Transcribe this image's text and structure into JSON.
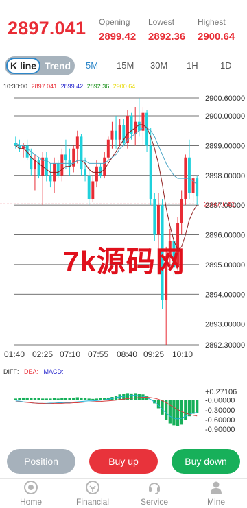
{
  "header": {
    "price": "2897.041",
    "opening_label": "Opening",
    "opening_value": "2899.42",
    "lowest_label": "Lowest",
    "lowest_value": "2892.36",
    "highest_label": "Highest",
    "highest_value": "2900.64"
  },
  "tabs": {
    "kline_label": "K line",
    "trend_label": "Trend",
    "periods": [
      "5M",
      "15M",
      "30M",
      "1H",
      "1D"
    ],
    "active_period": "5M"
  },
  "ma_legend": {
    "time": "10:30:00",
    "v1": "2897.041",
    "v2": "2899.42",
    "v3": "2892.36",
    "v4": "2900.64"
  },
  "watermark": "7k源码网",
  "macd_legend": {
    "diff": "DIFF:",
    "dea": "DEA:",
    "macd": "MACD:"
  },
  "buttons": {
    "position": "Position",
    "buy_up": "Buy up",
    "buy_down": "Buy down"
  },
  "nav": {
    "home": "Home",
    "financial": "Financial",
    "service": "Service",
    "mine": "Mine"
  },
  "colors": {
    "up": "#e82c35",
    "down": "#1fd1dc",
    "ma1": "#8e1c1c",
    "ma2": "#4da6c7",
    "accent": "#2e87c9",
    "green": "#17b05a"
  },
  "chart_data": {
    "type": "candlestick",
    "price_axis_labels": [
      "2900.60000",
      "2900.00000",
      "2899.00000",
      "2898.00000",
      "2897.00000",
      "2896.00000",
      "2895.00000",
      "2894.00000",
      "2893.00000",
      "2892.30000"
    ],
    "price_axis_values": [
      2900.6,
      2900.0,
      2899.0,
      2898.0,
      2897.0,
      2896.0,
      2895.0,
      2894.0,
      2893.0,
      2892.3
    ],
    "current_price_label": "2897.041",
    "current_price": 2897.041,
    "time_labels": [
      "01:40",
      "02:25",
      "07:10",
      "07:55",
      "08:40",
      "09:25",
      "10:10"
    ],
    "ylim": [
      2892.3,
      2900.6
    ],
    "candles": [
      [
        2899.1,
        2899.3,
        2898.9,
        2899.0
      ],
      [
        2899.0,
        2899.2,
        2898.8,
        2898.9
      ],
      [
        2898.9,
        2899.1,
        2898.6,
        2899.0
      ],
      [
        2899.0,
        2899.2,
        2898.5,
        2898.6
      ],
      [
        2898.6,
        2898.9,
        2898.0,
        2898.2
      ],
      [
        2898.2,
        2898.7,
        2897.5,
        2898.5
      ],
      [
        2898.5,
        2898.6,
        2897.9,
        2898.0
      ],
      [
        2898.0,
        2898.8,
        2897.0,
        2898.6
      ],
      [
        2898.6,
        2898.8,
        2897.8,
        2898.0
      ],
      [
        2898.0,
        2898.4,
        2897.6,
        2897.8
      ],
      [
        2897.8,
        2898.6,
        2897.4,
        2898.4
      ],
      [
        2898.4,
        2898.5,
        2897.9,
        2898.0
      ],
      [
        2898.0,
        2898.9,
        2897.8,
        2898.7
      ],
      [
        2898.7,
        2899.2,
        2898.2,
        2898.5
      ],
      [
        2898.5,
        2898.9,
        2898.0,
        2898.3
      ],
      [
        2898.3,
        2899.0,
        2898.1,
        2898.9
      ],
      [
        2898.9,
        2899.5,
        2898.4,
        2899.3
      ],
      [
        2899.3,
        2899.4,
        2898.0,
        2898.2
      ],
      [
        2898.2,
        2898.6,
        2897.8,
        2898.0
      ],
      [
        2898.0,
        2898.3,
        2897.0,
        2897.2
      ],
      [
        2897.2,
        2898.0,
        2897.1,
        2897.8
      ],
      [
        2897.8,
        2898.5,
        2897.6,
        2898.3
      ],
      [
        2898.3,
        2898.4,
        2897.9,
        2898.0
      ],
      [
        2898.0,
        2898.8,
        2897.9,
        2898.6
      ],
      [
        2898.6,
        2899.3,
        2898.5,
        2899.2
      ],
      [
        2899.2,
        2899.8,
        2898.9,
        2899.5
      ],
      [
        2899.5,
        2900.0,
        2898.9,
        2899.2
      ],
      [
        2899.2,
        2899.9,
        2899.0,
        2899.7
      ],
      [
        2899.7,
        2899.9,
        2899.0,
        2899.1
      ],
      [
        2899.1,
        2900.2,
        2898.9,
        2900.0
      ],
      [
        2900.0,
        2900.1,
        2899.2,
        2899.4
      ],
      [
        2899.4,
        2900.3,
        2899.0,
        2899.8
      ],
      [
        2899.8,
        2900.6,
        2899.3,
        2899.5
      ],
      [
        2899.5,
        2900.3,
        2899.0,
        2900.1
      ],
      [
        2900.1,
        2900.2,
        2898.8,
        2899.0
      ],
      [
        2899.0,
        2899.6,
        2897.0,
        2897.2
      ],
      [
        2897.2,
        2897.4,
        2895.8,
        2896.0
      ],
      [
        2896.0,
        2897.4,
        2895.5,
        2897.0
      ],
      [
        2897.0,
        2897.2,
        2893.5,
        2893.8
      ],
      [
        2893.8,
        2895.6,
        2892.3,
        2895.3
      ],
      [
        2895.3,
        2896.2,
        2895.0,
        2895.8
      ],
      [
        2895.8,
        2896.0,
        2894.6,
        2894.9
      ],
      [
        2894.9,
        2896.6,
        2894.8,
        2896.4
      ],
      [
        2896.4,
        2897.5,
        2896.0,
        2897.2
      ],
      [
        2897.2,
        2898.7,
        2897.0,
        2898.6
      ],
      [
        2898.6,
        2899.2,
        2897.2,
        2897.4
      ],
      [
        2897.4,
        2898.0,
        2897.1,
        2897.9
      ],
      [
        2897.9,
        2898.0,
        2897.0,
        2897.3
      ]
    ],
    "ma1": [
      2899.0,
      2898.9,
      2898.9,
      2898.8,
      2898.6,
      2898.5,
      2898.4,
      2898.3,
      2898.2,
      2898.1,
      2898.1,
      2898.1,
      2898.2,
      2898.3,
      2898.3,
      2898.4,
      2898.5,
      2898.5,
      2898.4,
      2898.2,
      2898.1,
      2898.1,
      2898.1,
      2898.2,
      2898.4,
      2898.6,
      2898.8,
      2899.0,
      2899.2,
      2899.4,
      2899.5,
      2899.6,
      2899.7,
      2899.7,
      2899.6,
      2899.3,
      2898.9,
      2898.4,
      2897.7,
      2896.9,
      2896.3,
      2895.8,
      2895.5,
      2895.6,
      2896.0,
      2896.5,
      2896.8,
      2897.0
    ],
    "ma2": [
      2899.1,
      2899.0,
      2899.0,
      2898.9,
      2898.8,
      2898.7,
      2898.6,
      2898.5,
      2898.5,
      2898.4,
      2898.4,
      2898.4,
      2898.4,
      2898.4,
      2898.4,
      2898.4,
      2898.5,
      2898.5,
      2898.5,
      2898.4,
      2898.4,
      2898.4,
      2898.4,
      2898.4,
      2898.5,
      2898.6,
      2898.7,
      2898.9,
      2899.0,
      2899.2,
      2899.3,
      2899.4,
      2899.5,
      2899.6,
      2899.6,
      2899.5,
      2899.3,
      2899.0,
      2898.7,
      2898.4,
      2898.2,
      2898.0,
      2897.9,
      2897.9,
      2897.9,
      2897.9,
      2897.8,
      2897.7
    ],
    "macd_axis_labels": [
      "+0.27106",
      "-0.00000",
      "-0.30000",
      "-0.60000",
      "-0.90000"
    ],
    "macd_axis_values": [
      0.27106,
      0.0,
      -0.3,
      -0.6,
      -0.9
    ],
    "macd_hist": [
      0.05,
      0.07,
      0.08,
      0.08,
      0.07,
      0.06,
      0.06,
      0.05,
      0.05,
      0.05,
      0.06,
      0.05,
      0.06,
      0.07,
      0.07,
      0.08,
      0.09,
      0.08,
      0.07,
      0.05,
      0.04,
      0.05,
      0.06,
      0.07,
      0.08,
      0.1,
      0.14,
      0.18,
      0.2,
      0.22,
      0.21,
      0.22,
      0.2,
      0.18,
      0.12,
      0.02,
      -0.1,
      -0.25,
      -0.45,
      -0.62,
      -0.72,
      -0.78,
      -0.8,
      -0.76,
      -0.62,
      -0.5,
      -0.42,
      -0.4
    ],
    "macd_diff": [
      -0.02,
      -0.03,
      -0.05,
      -0.06,
      -0.08,
      -0.09,
      -0.1,
      -0.1,
      -0.1,
      -0.09,
      -0.09,
      -0.08,
      -0.08,
      -0.07,
      -0.07,
      -0.06,
      -0.05,
      -0.04,
      -0.03,
      -0.02,
      -0.02,
      -0.01,
      0.0,
      0.01,
      0.03,
      0.05,
      0.08,
      0.1,
      0.12,
      0.14,
      0.15,
      0.15,
      0.14,
      0.12,
      0.08,
      0.02,
      -0.06,
      -0.16,
      -0.28,
      -0.4,
      -0.5,
      -0.56,
      -0.58,
      -0.56,
      -0.5,
      -0.44,
      -0.4,
      -0.38
    ],
    "macd_dea": [
      -0.05,
      -0.05,
      -0.06,
      -0.07,
      -0.08,
      -0.09,
      -0.1,
      -0.1,
      -0.11,
      -0.11,
      -0.1,
      -0.1,
      -0.1,
      -0.09,
      -0.09,
      -0.08,
      -0.08,
      -0.07,
      -0.06,
      -0.06,
      -0.05,
      -0.04,
      -0.04,
      -0.03,
      -0.02,
      -0.01,
      0.0,
      0.02,
      0.03,
      0.05,
      0.06,
      0.07,
      0.08,
      0.09,
      0.09,
      0.08,
      0.06,
      0.03,
      -0.02,
      -0.08,
      -0.15,
      -0.22,
      -0.29,
      -0.35,
      -0.4,
      -0.44,
      -0.47,
      -0.49
    ]
  }
}
